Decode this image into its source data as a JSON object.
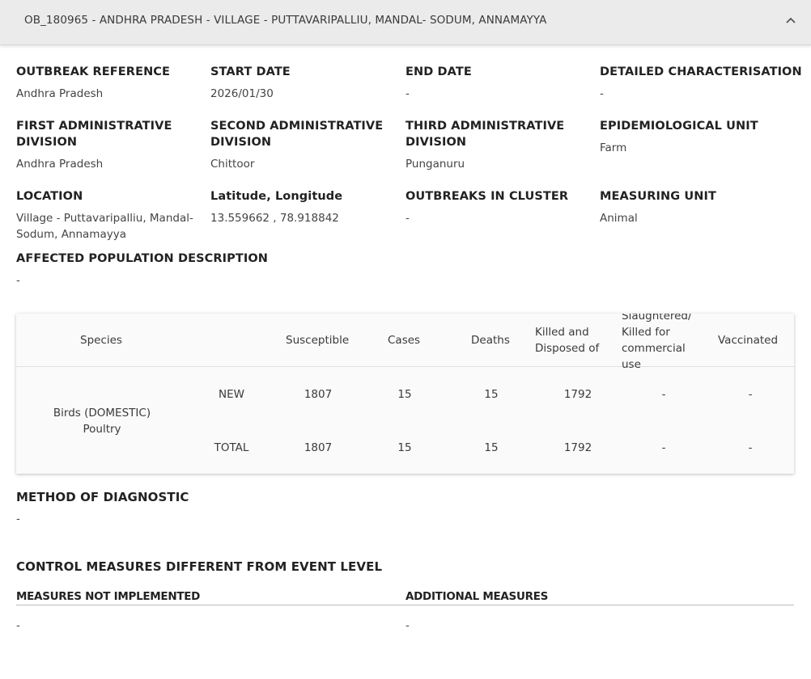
{
  "header": {
    "title": "OB_180965 - ANDHRA PRADESH - VILLAGE - PUTTAVARIPALLIU, MANDAL- SODUM, ANNAMAYYA",
    "toggle_icon": "chevron-up-icon"
  },
  "details": {
    "outbreak_reference": {
      "label": "OUTBREAK REFERENCE",
      "value": "Andhra Pradesh"
    },
    "start_date": {
      "label": "START DATE",
      "value": "2026/01/30"
    },
    "end_date": {
      "label": "END DATE",
      "value": "-"
    },
    "detailed_characterisation": {
      "label": "DETAILED CHARACTERISATION",
      "value": "-"
    },
    "first_admin": {
      "label": "FIRST ADMINISTRATIVE DIVISION",
      "value": "Andhra Pradesh"
    },
    "second_admin": {
      "label": "SECOND ADMINISTRATIVE DIVISION",
      "value": "Chittoor"
    },
    "third_admin": {
      "label": "THIRD ADMINISTRATIVE DIVISION",
      "value": "Punganuru"
    },
    "epidemiological_unit": {
      "label": "EPIDEMIOLOGICAL UNIT",
      "value": "Farm"
    },
    "location": {
      "label": "LOCATION",
      "value": "Village - Puttavaripalliu, Mandal- Sodum, Annamayya"
    },
    "lat_long": {
      "label": "Latitude, Longitude",
      "value": "13.559662 , 78.918842"
    },
    "outbreaks_in_cluster": {
      "label": "OUTBREAKS IN CLUSTER",
      "value": "-"
    },
    "measuring_unit": {
      "label": "MEASURING UNIT",
      "value": "Animal"
    },
    "affected_population": {
      "label": "AFFECTED POPULATION DESCRIPTION",
      "value": "-"
    }
  },
  "table": {
    "headers": {
      "species": "Species",
      "susceptible": "Susceptible",
      "cases": "Cases",
      "deaths": "Deaths",
      "killed": "Killed and Disposed of",
      "slaughtered": "Slaughtered/ Killed for commercial use",
      "vaccinated": "Vaccinated"
    },
    "species": "Birds (DOMESTIC) Poultry",
    "rows": [
      {
        "type": "NEW",
        "susceptible": "1807",
        "cases": "15",
        "deaths": "15",
        "killed": "1792",
        "slaughtered": "-",
        "vaccinated": "-"
      },
      {
        "type": "TOTAL",
        "susceptible": "1807",
        "cases": "15",
        "deaths": "15",
        "killed": "1792",
        "slaughtered": "-",
        "vaccinated": "-"
      }
    ]
  },
  "method_of_diagnostic": {
    "label": "METHOD OF DIAGNOSTIC",
    "value": "-"
  },
  "control_measures": {
    "title": "CONTROL MEASURES DIFFERENT FROM EVENT LEVEL",
    "not_implemented": {
      "label": "MEASURES NOT IMPLEMENTED",
      "value": "-"
    },
    "additional": {
      "label": "ADDITIONAL MEASURES",
      "value": "-"
    }
  }
}
